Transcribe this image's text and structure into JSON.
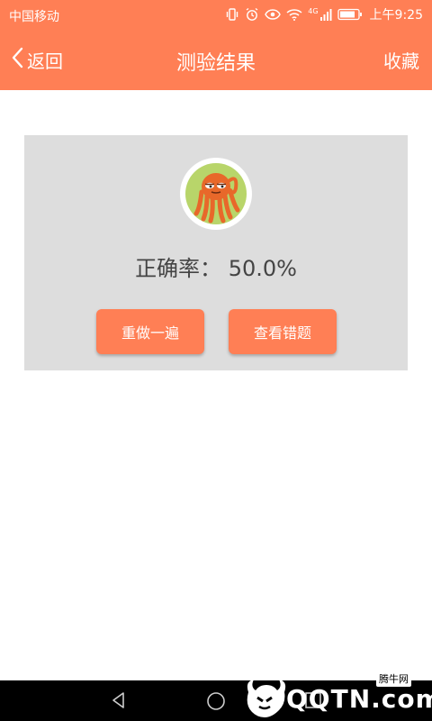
{
  "status_bar": {
    "carrier": "中国移动",
    "network": "4G",
    "time": "上午9:25"
  },
  "header": {
    "back_label": "返回",
    "title": "测验结果",
    "favorite_label": "收藏"
  },
  "result": {
    "accuracy_text": "正确率： 50.0%",
    "redo_label": "重做一遍",
    "view_wrong_label": "查看错题"
  },
  "watermark": {
    "text": "QQTN.com",
    "chinese": "腾牛网"
  },
  "colors": {
    "accent": "#ff7f55",
    "card_bg": "#dddddd",
    "text": "#444444"
  },
  "icons": [
    "vibrate-icon",
    "alarm-icon",
    "eye-icon",
    "wifi-icon",
    "signal-icon",
    "battery-icon",
    "back-chevron-icon",
    "octopus-avatar",
    "nav-back-icon",
    "nav-home-icon",
    "nav-recents-icon"
  ]
}
